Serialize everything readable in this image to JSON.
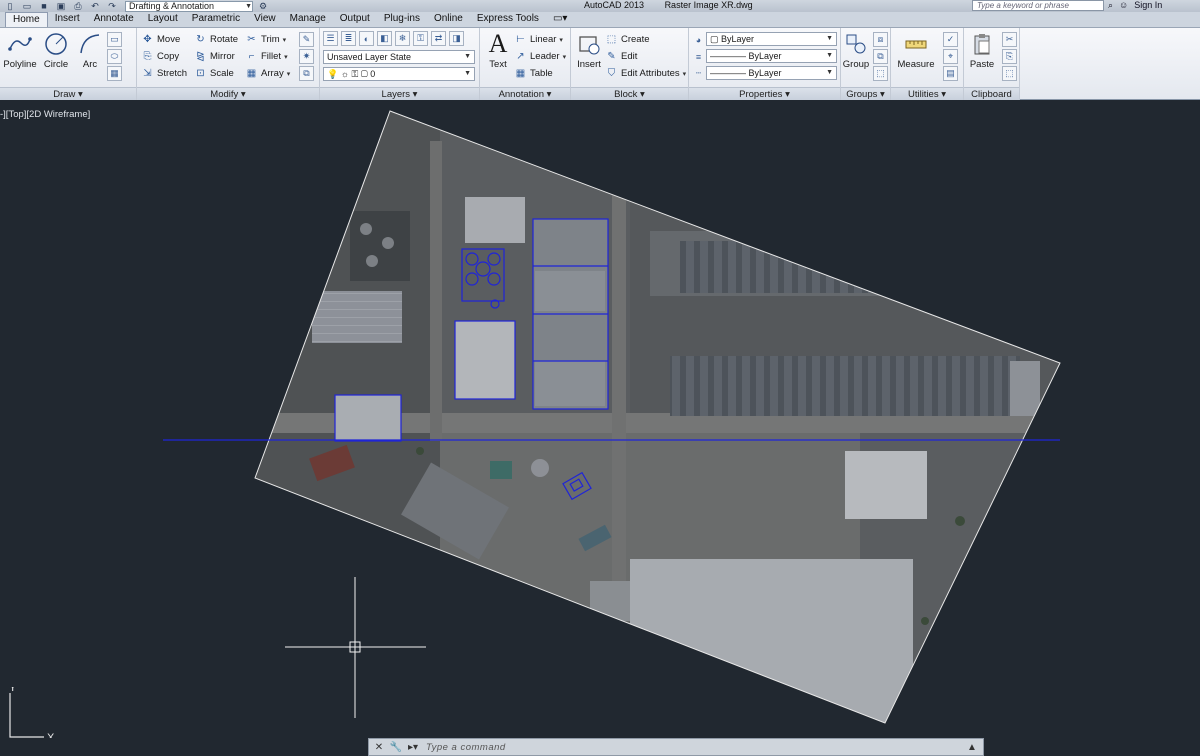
{
  "titlebar": {
    "workspace": "Drafting & Annotation",
    "app_name": "AutoCAD 2013",
    "file_name": "Raster Image XR.dwg",
    "search_placeholder": "Type a keyword or phrase",
    "sign_in": "Sign In"
  },
  "tabs": [
    "Home",
    "Insert",
    "Annotate",
    "Layout",
    "Parametric",
    "View",
    "Manage",
    "Output",
    "Plug-ins",
    "Online",
    "Express Tools"
  ],
  "ribbon": {
    "draw": {
      "title": "Draw",
      "polyline": "Polyline",
      "circle": "Circle",
      "arc": "Arc"
    },
    "modify": {
      "title": "Modify",
      "move": "Move",
      "rotate": "Rotate",
      "trim": "Trim",
      "copy": "Copy",
      "mirror": "Mirror",
      "fillet": "Fillet",
      "stretch": "Stretch",
      "scale": "Scale",
      "array": "Array"
    },
    "layers": {
      "title": "Layers",
      "layer_state": "Unsaved Layer State",
      "current_layer": "0"
    },
    "annotation": {
      "title": "Annotation",
      "text": "Text",
      "linear": "Linear",
      "leader": "Leader",
      "table": "Table"
    },
    "block": {
      "title": "Block",
      "insert": "Insert",
      "create": "Create",
      "edit": "Edit",
      "edit_attributes": "Edit Attributes"
    },
    "properties": {
      "title": "Properties",
      "color": "ByLayer",
      "lineweight": "ByLayer",
      "linetype": "ByLayer"
    },
    "groups": {
      "title": "Groups",
      "group": "Group"
    },
    "utilities": {
      "title": "Utilities",
      "measure": "Measure"
    },
    "clipboard": {
      "title": "Clipboard",
      "paste": "Paste"
    }
  },
  "viewport": {
    "label": "-][Top][2D Wireframe]"
  },
  "ucs": {
    "x_label": "X",
    "y_label": "Y"
  },
  "command": {
    "placeholder": "Type a command"
  },
  "colors": {
    "background": "#212830",
    "selection_blue": "#1f24d8",
    "ribbon": "#eef1f6"
  }
}
